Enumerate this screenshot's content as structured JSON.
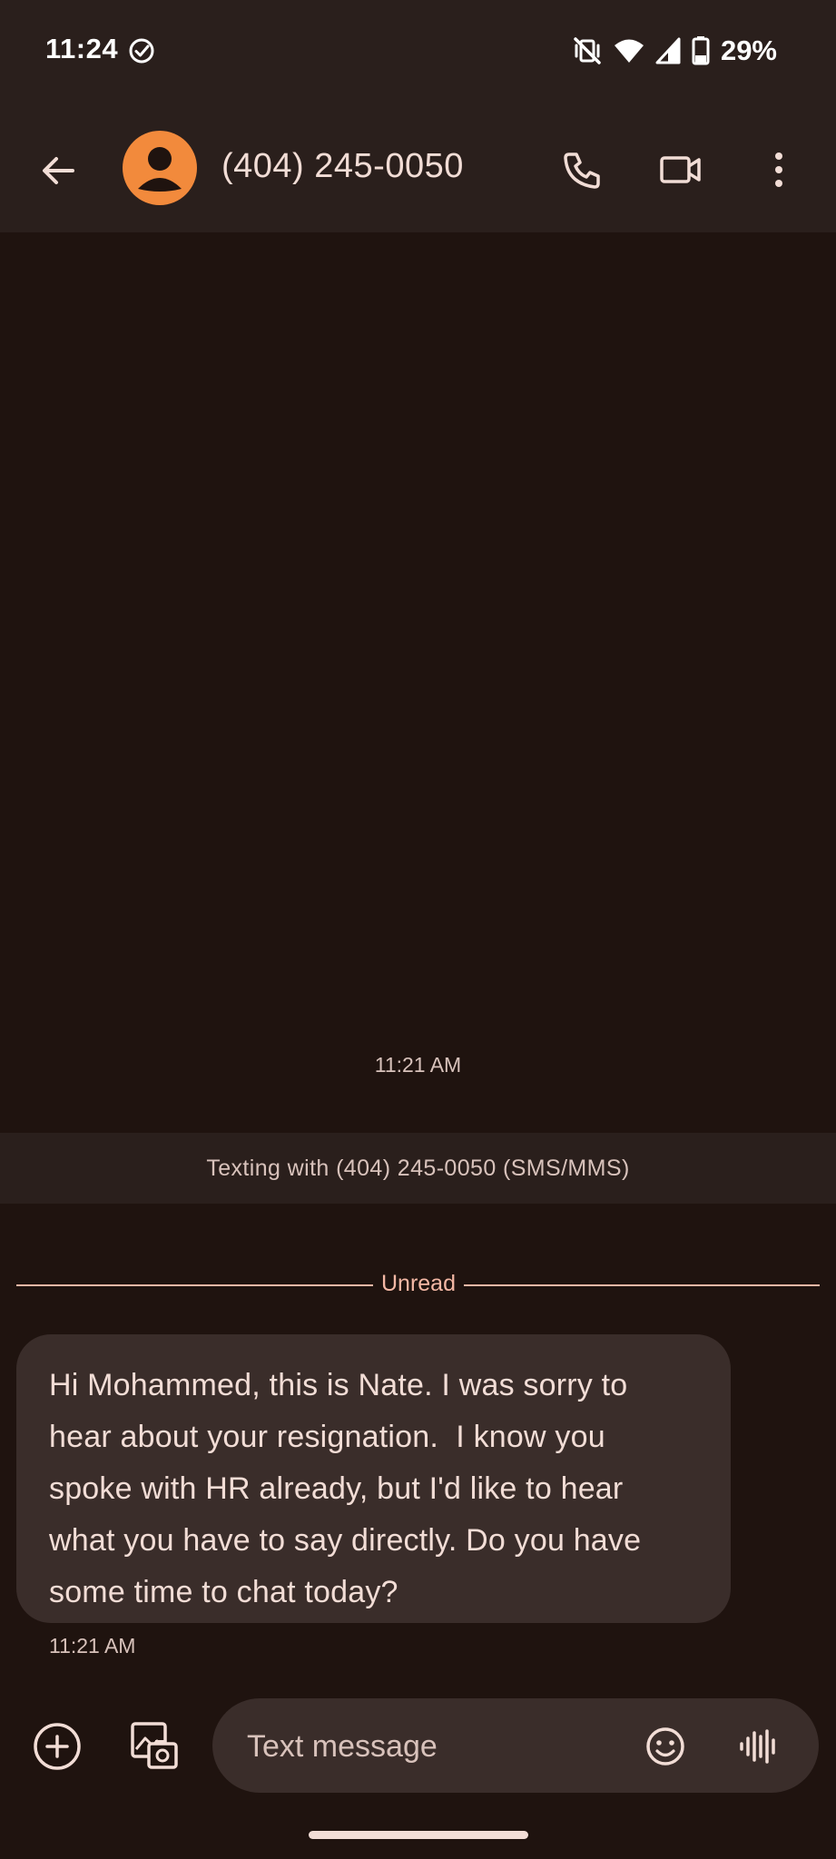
{
  "status_bar": {
    "time": "11:24",
    "battery_percent": "29%",
    "icons": [
      "check-circle-icon",
      "vibrate-off-icon",
      "wifi-icon",
      "signal-icon",
      "battery-icon"
    ]
  },
  "header": {
    "contact_name": "(404) 245-0050",
    "avatar_color": "#f28a3c",
    "icons": [
      "back-arrow-icon",
      "avatar-person-icon",
      "phone-icon",
      "video-call-icon",
      "more-vert-icon"
    ]
  },
  "conversation": {
    "top_timestamp": "11:21 AM",
    "banner": "Texting with (404) 245-0050 (SMS/MMS)",
    "unread_label": "Unread",
    "messages": [
      {
        "text": "Hi Mohammed, this is Nate. I was sorry to hear about your resignation.  I know you spoke with HR already, but I'd like to hear what you have to say directly. Do you have some time to chat today?",
        "lines": [
          "Hi Mohammed, this is Nate. I was sorry to",
          "hear about your resignation.  I know you",
          "spoke with HR already, but I'd like to hear",
          "what you have to say directly. Do you have",
          "some time to chat today?"
        ],
        "time": "11:21 AM",
        "direction": "incoming"
      }
    ]
  },
  "composer": {
    "placeholder": "Text message",
    "value": "",
    "icons": [
      "add-circle-icon",
      "gallery-icon",
      "emoji-icon",
      "voice-input-icon"
    ]
  },
  "colors": {
    "background": "#1f130f",
    "surface": "#2a1f1c",
    "bubble": "#3a2d2a",
    "accent": "#f4b8a5",
    "text": "#f2ddd6"
  }
}
